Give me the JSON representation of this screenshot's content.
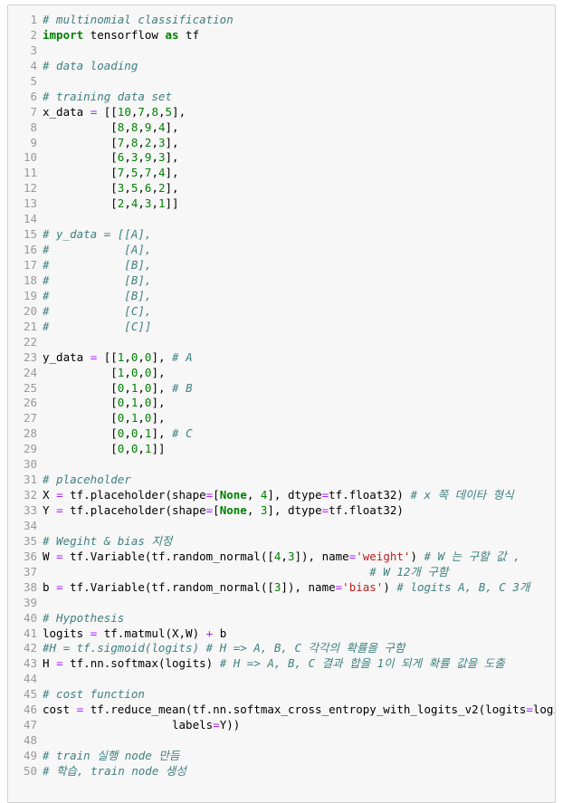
{
  "editor": {
    "lines": [
      [
        {
          "t": "# multinomial classification",
          "c": "c"
        }
      ],
      [
        {
          "t": "import",
          "c": "k"
        },
        {
          "t": " tensorflow "
        },
        {
          "t": "as",
          "c": "k"
        },
        {
          "t": " tf"
        }
      ],
      [],
      [
        {
          "t": "# data loading",
          "c": "c"
        }
      ],
      [],
      [
        {
          "t": "# training data set",
          "c": "c"
        }
      ],
      [
        {
          "t": "x_data "
        },
        {
          "t": "=",
          "c": "o"
        },
        {
          "t": " [["
        },
        {
          "t": "10",
          "c": "n"
        },
        {
          "t": ","
        },
        {
          "t": "7",
          "c": "n"
        },
        {
          "t": ","
        },
        {
          "t": "8",
          "c": "n"
        },
        {
          "t": ","
        },
        {
          "t": "5",
          "c": "n"
        },
        {
          "t": "],"
        }
      ],
      [
        {
          "t": "          ["
        },
        {
          "t": "8",
          "c": "n"
        },
        {
          "t": ","
        },
        {
          "t": "8",
          "c": "n"
        },
        {
          "t": ","
        },
        {
          "t": "9",
          "c": "n"
        },
        {
          "t": ","
        },
        {
          "t": "4",
          "c": "n"
        },
        {
          "t": "],"
        }
      ],
      [
        {
          "t": "          ["
        },
        {
          "t": "7",
          "c": "n"
        },
        {
          "t": ","
        },
        {
          "t": "8",
          "c": "n"
        },
        {
          "t": ","
        },
        {
          "t": "2",
          "c": "n"
        },
        {
          "t": ","
        },
        {
          "t": "3",
          "c": "n"
        },
        {
          "t": "],"
        }
      ],
      [
        {
          "t": "          ["
        },
        {
          "t": "6",
          "c": "n"
        },
        {
          "t": ","
        },
        {
          "t": "3",
          "c": "n"
        },
        {
          "t": ","
        },
        {
          "t": "9",
          "c": "n"
        },
        {
          "t": ","
        },
        {
          "t": "3",
          "c": "n"
        },
        {
          "t": "],"
        }
      ],
      [
        {
          "t": "          ["
        },
        {
          "t": "7",
          "c": "n"
        },
        {
          "t": ","
        },
        {
          "t": "5",
          "c": "n"
        },
        {
          "t": ","
        },
        {
          "t": "7",
          "c": "n"
        },
        {
          "t": ","
        },
        {
          "t": "4",
          "c": "n"
        },
        {
          "t": "],"
        }
      ],
      [
        {
          "t": "          ["
        },
        {
          "t": "3",
          "c": "n"
        },
        {
          "t": ","
        },
        {
          "t": "5",
          "c": "n"
        },
        {
          "t": ","
        },
        {
          "t": "6",
          "c": "n"
        },
        {
          "t": ","
        },
        {
          "t": "2",
          "c": "n"
        },
        {
          "t": "],"
        }
      ],
      [
        {
          "t": "          ["
        },
        {
          "t": "2",
          "c": "n"
        },
        {
          "t": ","
        },
        {
          "t": "4",
          "c": "n"
        },
        {
          "t": ","
        },
        {
          "t": "3",
          "c": "n"
        },
        {
          "t": ","
        },
        {
          "t": "1",
          "c": "n"
        },
        {
          "t": "]]"
        }
      ],
      [],
      [
        {
          "t": "# y_data = [[A],",
          "c": "c"
        }
      ],
      [
        {
          "t": "#           [A],",
          "c": "c"
        }
      ],
      [
        {
          "t": "#           [B],",
          "c": "c"
        }
      ],
      [
        {
          "t": "#           [B],",
          "c": "c"
        }
      ],
      [
        {
          "t": "#           [B],",
          "c": "c"
        }
      ],
      [
        {
          "t": "#           [C],",
          "c": "c"
        }
      ],
      [
        {
          "t": "#           [C]]",
          "c": "c"
        }
      ],
      [],
      [
        {
          "t": "y_data "
        },
        {
          "t": "=",
          "c": "o"
        },
        {
          "t": " [["
        },
        {
          "t": "1",
          "c": "n"
        },
        {
          "t": ","
        },
        {
          "t": "0",
          "c": "n"
        },
        {
          "t": ","
        },
        {
          "t": "0",
          "c": "n"
        },
        {
          "t": "], "
        },
        {
          "t": "# A",
          "c": "c"
        }
      ],
      [
        {
          "t": "          ["
        },
        {
          "t": "1",
          "c": "n"
        },
        {
          "t": ","
        },
        {
          "t": "0",
          "c": "n"
        },
        {
          "t": ","
        },
        {
          "t": "0",
          "c": "n"
        },
        {
          "t": "],"
        }
      ],
      [
        {
          "t": "          ["
        },
        {
          "t": "0",
          "c": "n"
        },
        {
          "t": ","
        },
        {
          "t": "1",
          "c": "n"
        },
        {
          "t": ","
        },
        {
          "t": "0",
          "c": "n"
        },
        {
          "t": "], "
        },
        {
          "t": "# B",
          "c": "c"
        }
      ],
      [
        {
          "t": "          ["
        },
        {
          "t": "0",
          "c": "n"
        },
        {
          "t": ","
        },
        {
          "t": "1",
          "c": "n"
        },
        {
          "t": ","
        },
        {
          "t": "0",
          "c": "n"
        },
        {
          "t": "],"
        }
      ],
      [
        {
          "t": "          ["
        },
        {
          "t": "0",
          "c": "n"
        },
        {
          "t": ","
        },
        {
          "t": "1",
          "c": "n"
        },
        {
          "t": ","
        },
        {
          "t": "0",
          "c": "n"
        },
        {
          "t": "],"
        }
      ],
      [
        {
          "t": "          ["
        },
        {
          "t": "0",
          "c": "n"
        },
        {
          "t": ","
        },
        {
          "t": "0",
          "c": "n"
        },
        {
          "t": ","
        },
        {
          "t": "1",
          "c": "n"
        },
        {
          "t": "], "
        },
        {
          "t": "# C",
          "c": "c"
        }
      ],
      [
        {
          "t": "          ["
        },
        {
          "t": "0",
          "c": "n"
        },
        {
          "t": ","
        },
        {
          "t": "0",
          "c": "n"
        },
        {
          "t": ","
        },
        {
          "t": "1",
          "c": "n"
        },
        {
          "t": "]]"
        }
      ],
      [],
      [
        {
          "t": "# placeholder",
          "c": "c"
        }
      ],
      [
        {
          "t": "X "
        },
        {
          "t": "=",
          "c": "o"
        },
        {
          "t": " tf.placeholder(shape"
        },
        {
          "t": "=",
          "c": "o"
        },
        {
          "t": "["
        },
        {
          "t": "None",
          "c": "k"
        },
        {
          "t": ", "
        },
        {
          "t": "4",
          "c": "n"
        },
        {
          "t": "], dtype"
        },
        {
          "t": "=",
          "c": "o"
        },
        {
          "t": "tf.float32) "
        },
        {
          "t": "# x 쪽 데이타 형식",
          "c": "c"
        }
      ],
      [
        {
          "t": "Y "
        },
        {
          "t": "=",
          "c": "o"
        },
        {
          "t": " tf.placeholder(shape"
        },
        {
          "t": "=",
          "c": "o"
        },
        {
          "t": "["
        },
        {
          "t": "None",
          "c": "k"
        },
        {
          "t": ", "
        },
        {
          "t": "3",
          "c": "n"
        },
        {
          "t": "], dtype"
        },
        {
          "t": "=",
          "c": "o"
        },
        {
          "t": "tf.float32)"
        }
      ],
      [],
      [
        {
          "t": "# Wegiht & bias 지정",
          "c": "c"
        }
      ],
      [
        {
          "t": "W "
        },
        {
          "t": "=",
          "c": "o"
        },
        {
          "t": " tf.Variable(tf.random_normal(["
        },
        {
          "t": "4",
          "c": "n"
        },
        {
          "t": ","
        },
        {
          "t": "3",
          "c": "n"
        },
        {
          "t": "]), name"
        },
        {
          "t": "=",
          "c": "o"
        },
        {
          "t": "'weight'",
          "c": "s"
        },
        {
          "t": ") "
        },
        {
          "t": "# W 는 구할 값 ,",
          "c": "c"
        }
      ],
      [
        {
          "t": "                                                "
        },
        {
          "t": "# W 12개 구함",
          "c": "c"
        }
      ],
      [
        {
          "t": "b "
        },
        {
          "t": "=",
          "c": "o"
        },
        {
          "t": " tf.Variable(tf.random_normal(["
        },
        {
          "t": "3",
          "c": "n"
        },
        {
          "t": "]), name"
        },
        {
          "t": "=",
          "c": "o"
        },
        {
          "t": "'bias'",
          "c": "s"
        },
        {
          "t": ") "
        },
        {
          "t": "# logits A, B, C 3개",
          "c": "c"
        }
      ],
      [],
      [
        {
          "t": "# Hypothesis",
          "c": "c"
        }
      ],
      [
        {
          "t": "logits "
        },
        {
          "t": "=",
          "c": "o"
        },
        {
          "t": " tf.matmul(X,W) "
        },
        {
          "t": "+",
          "c": "o"
        },
        {
          "t": " b"
        }
      ],
      [
        {
          "t": "#H = tf.sigmoid(logits) # H => A, B, C 각각의 확률을 구함",
          "c": "c"
        }
      ],
      [
        {
          "t": "H "
        },
        {
          "t": "=",
          "c": "o"
        },
        {
          "t": " tf.nn.softmax(logits) "
        },
        {
          "t": "# H => A, B, C 결과 합을 1이 되게 확률 값을 도출",
          "c": "c"
        }
      ],
      [],
      [
        {
          "t": "# cost function",
          "c": "c"
        }
      ],
      [
        {
          "t": "cost "
        },
        {
          "t": "=",
          "c": "o"
        },
        {
          "t": " tf.reduce_mean(tf.nn.softmax_cross_entropy_with_logits_v2(logits"
        },
        {
          "t": "=",
          "c": "o"
        },
        {
          "t": "logits,"
        }
      ],
      [
        {
          "t": "                   labels"
        },
        {
          "t": "=",
          "c": "o"
        },
        {
          "t": "Y))"
        }
      ],
      [],
      [
        {
          "t": "# train 실행 node 만듬",
          "c": "c"
        }
      ],
      [
        {
          "t": "# 학습, train node 생성",
          "c": "c"
        }
      ]
    ]
  }
}
